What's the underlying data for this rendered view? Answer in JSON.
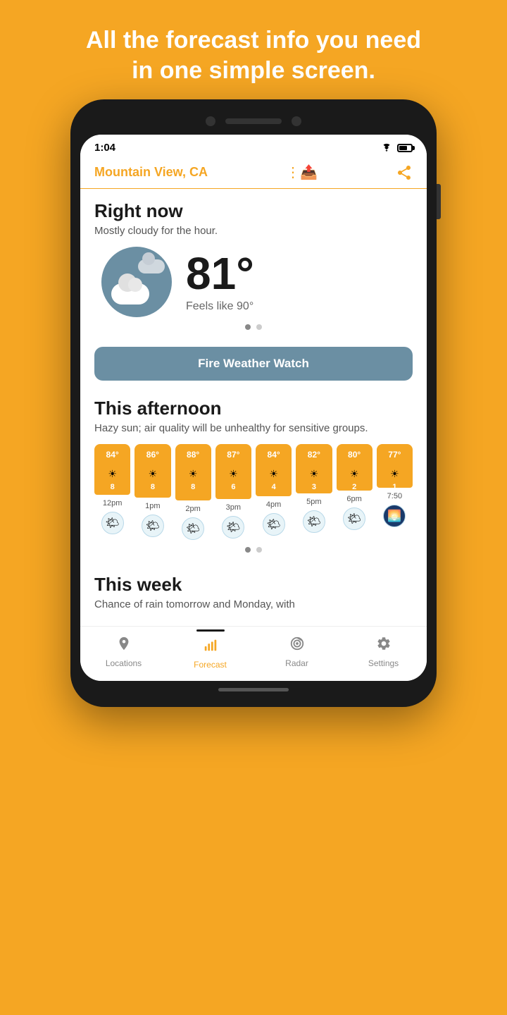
{
  "headline": {
    "line1": "All the forecast info you need",
    "line2": "in one simple screen."
  },
  "status_bar": {
    "time": "1:04"
  },
  "location": {
    "city": "Mountain View, CA"
  },
  "right_now": {
    "title": "Right now",
    "subtitle": "Mostly cloudy for the hour.",
    "temperature": "81°",
    "feels_like": "Feels like 90°"
  },
  "alert": {
    "text": "Fire Weather Watch"
  },
  "afternoon": {
    "title": "This afternoon",
    "subtitle": "Hazy sun; air quality will be unhealthy for sensitive groups.",
    "hours": [
      {
        "time": "12pm",
        "temp": "84°",
        "uv": "8",
        "icon": "🌤"
      },
      {
        "time": "1pm",
        "temp": "86°",
        "uv": "8",
        "icon": "🌤"
      },
      {
        "time": "2pm",
        "temp": "88°",
        "uv": "8",
        "icon": "🌤"
      },
      {
        "time": "3pm",
        "temp": "87°",
        "uv": "6",
        "icon": "🌤"
      },
      {
        "time": "4pm",
        "temp": "84°",
        "uv": "4",
        "icon": "🌤"
      },
      {
        "time": "5pm",
        "temp": "82°",
        "uv": "3",
        "icon": "🌤"
      },
      {
        "time": "6pm",
        "temp": "80°",
        "uv": "2",
        "icon": "🌤"
      },
      {
        "time": "7:50",
        "temp": "77°",
        "uv": "1",
        "icon": "sunset"
      }
    ]
  },
  "week": {
    "title": "This week",
    "subtitle": "Chance of rain tomorrow and Monday, with"
  },
  "nav": {
    "items": [
      {
        "label": "Locations",
        "icon": "📍",
        "active": false
      },
      {
        "label": "Forecast",
        "icon": "📊",
        "active": true
      },
      {
        "label": "Radar",
        "icon": "🎯",
        "active": false
      },
      {
        "label": "Settings",
        "icon": "⚙",
        "active": false
      }
    ]
  }
}
